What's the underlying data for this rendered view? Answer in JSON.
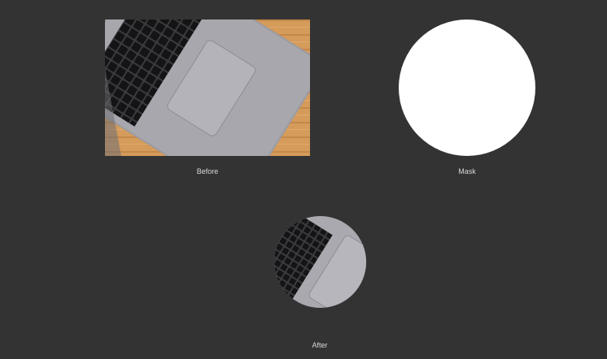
{
  "panels": {
    "before": {
      "caption": "Before",
      "image": "laptop-photo"
    },
    "mask": {
      "caption": "Mask",
      "shape": "circle",
      "color": "#ffffff"
    },
    "after": {
      "caption": "After",
      "image": "laptop-photo-circle-cropped"
    }
  },
  "colors": {
    "background": "#333333",
    "caption": "#d9d9d9",
    "wood": "#d49a5a",
    "laptop": "#9a9aa0",
    "keys": "#1d1d1f"
  }
}
